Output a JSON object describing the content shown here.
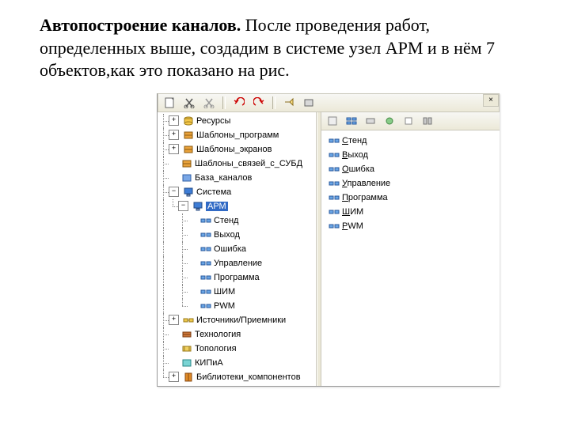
{
  "paragraph_bold": "Автопостроение каналов.",
  "paragraph_rest": " После проведения работ, определенных выше, создадим в системе узел АРМ и в нём 7 объектов,как это показано на рис.",
  "close_glyph": "×",
  "toolbar": {
    "buttons": [
      "sheet",
      "cut1",
      "cut2",
      "undo",
      "redo",
      "tag",
      "box"
    ]
  },
  "mini_toolbar_placeholder": "",
  "tree": {
    "top": [
      {
        "label": "Ресурсы",
        "icon": "cylinder",
        "pm": "+"
      },
      {
        "label": "Шаблоны_программ",
        "icon": "box-orange",
        "pm": "+"
      },
      {
        "label": "Шаблоны_экранов",
        "icon": "box-orange",
        "pm": "+"
      },
      {
        "label": "Шаблоны_связей_с_СУБД",
        "icon": "box-orange",
        "pm": ""
      },
      {
        "label": "База_каналов",
        "icon": "box-blue",
        "pm": ""
      }
    ],
    "system_label": "Система",
    "arm_label": "АРМ",
    "arm_children": [
      "Стенд",
      "Выход",
      "Ошибка",
      "Управление",
      "Программа",
      "ШИМ",
      "PWM"
    ],
    "bottom": [
      {
        "label": "Источники/Приемники",
        "icon": "links",
        "pm": "+"
      },
      {
        "label": "Технология",
        "icon": "bricks",
        "pm": ""
      },
      {
        "label": "Топология",
        "icon": "net",
        "pm": ""
      },
      {
        "label": "КИПиА",
        "icon": "cyan",
        "pm": ""
      },
      {
        "label": "Библиотеки_компонентов",
        "icon": "book",
        "pm": "+"
      }
    ]
  },
  "right": [
    "Стенд",
    "Выход",
    "Ошибка",
    "Управление",
    "Программа",
    "ШИМ",
    "PWM"
  ]
}
